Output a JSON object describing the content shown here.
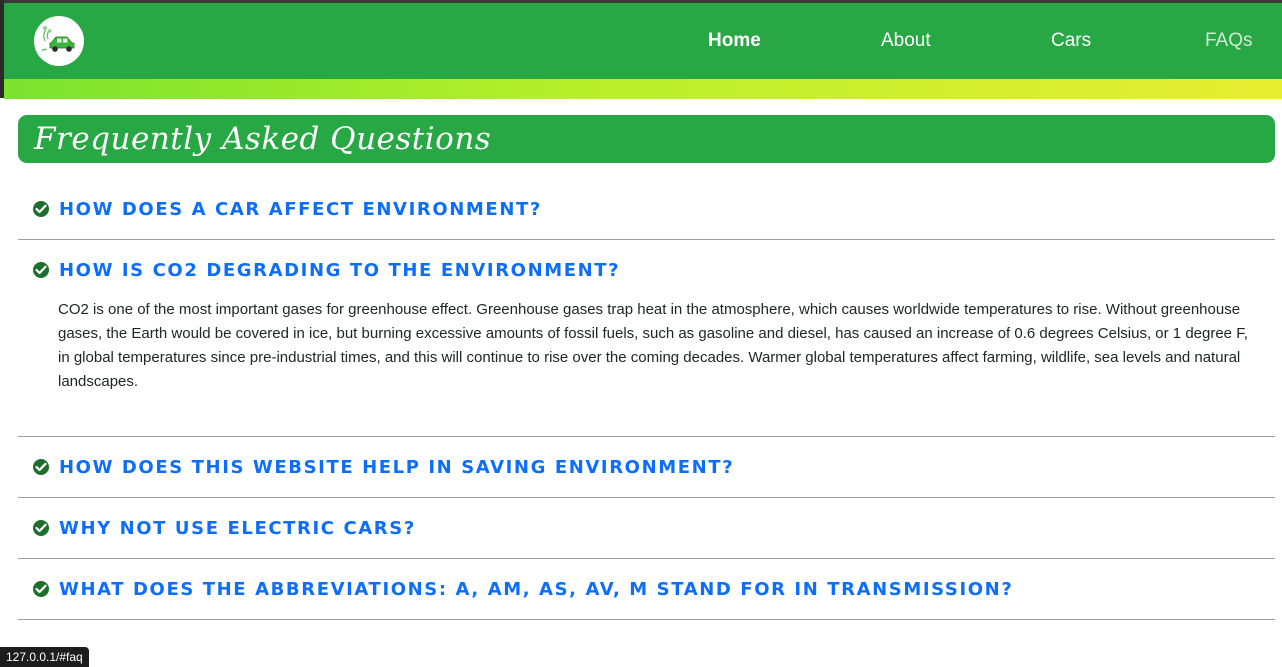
{
  "navbar": {
    "logo_icon": "electric-car-logo-icon",
    "links": [
      {
        "label": "Home",
        "state": "active"
      },
      {
        "label": "About"
      },
      {
        "label": "Cars"
      },
      {
        "label": "FAQs",
        "state": "hover"
      }
    ],
    "colors": {
      "background": "#28a745",
      "link": "#ffffff"
    }
  },
  "faq": {
    "title": "Frequently Asked Questions",
    "items": [
      {
        "question": "How does a car affect environment?"
      },
      {
        "question": "How is CO2 degrading to the environment?",
        "answer": "CO2 is one of the most important gases for greenhouse effect. Greenhouse gases trap heat in the atmosphere, which causes worldwide temperatures to rise. Without greenhouse gases, the Earth would be covered in ice, but burning excessive amounts of fossil fuels, such as gasoline and diesel, has caused an increase of 0.6 degrees Celsius, or 1 degree F, in global temperatures since pre-industrial times, and this will continue to rise over the coming decades. Warmer global temperatures affect farming, wildlife, sea levels and natural landscapes.",
        "expanded": true
      },
      {
        "question": "How does this website help in saving environment?"
      },
      {
        "question": "Why not use electric cars?"
      },
      {
        "question": "What does the abbreviations: A, AM, AS, AV, M stand for in transmission?"
      }
    ],
    "icon": "check-circle-icon",
    "colors": {
      "question": "#0d6efd",
      "check": "#1e6e2d",
      "title_bg": "#28a745"
    }
  },
  "status_bar": {
    "url": "127.0.0.1/#faq"
  }
}
